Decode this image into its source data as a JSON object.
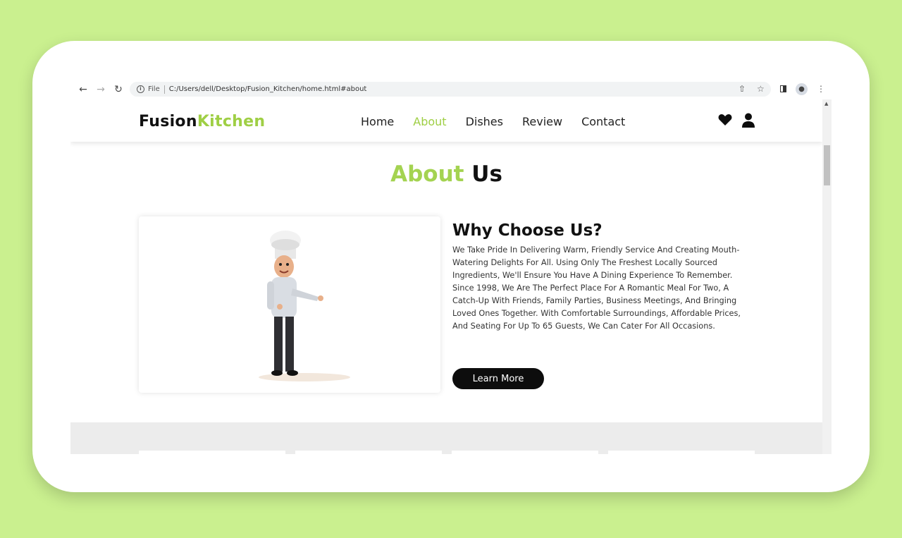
{
  "browser": {
    "file_label": "File",
    "url": "C:/Users/dell/Desktop/Fusion_Kitchen/home.html#about"
  },
  "logo": {
    "part1": "Fusion",
    "part2": "Kitchen"
  },
  "nav": [
    {
      "label": "Home",
      "active": false
    },
    {
      "label": "About",
      "active": true
    },
    {
      "label": "Dishes",
      "active": false
    },
    {
      "label": "Review",
      "active": false
    },
    {
      "label": "Contact",
      "active": false
    }
  ],
  "section": {
    "title_accent": "About",
    "title_rest": "Us"
  },
  "about": {
    "heading": "Why Choose Us?",
    "paragraph1": "We Take Pride In Delivering Warm, Friendly Service And Creating Mouth-Watering Delights For All. Using Only The Freshest Locally Sourced Ingredients, We'll Ensure You Have A Dining Experience To Remember.",
    "paragraph2": "Since 1998, We Are The Perfect Place For A Romantic Meal For Two, A Catch-Up With Friends, Family Parties, Business Meetings, And Bringing Loved Ones Together. With Comfortable Surroundings, Affordable Prices, And Seating For Up To 65 Guests, We Can Cater For All Occasions.",
    "button": "Learn More"
  },
  "colors": {
    "accent": "#9fcf45",
    "background": "#caf08f"
  }
}
